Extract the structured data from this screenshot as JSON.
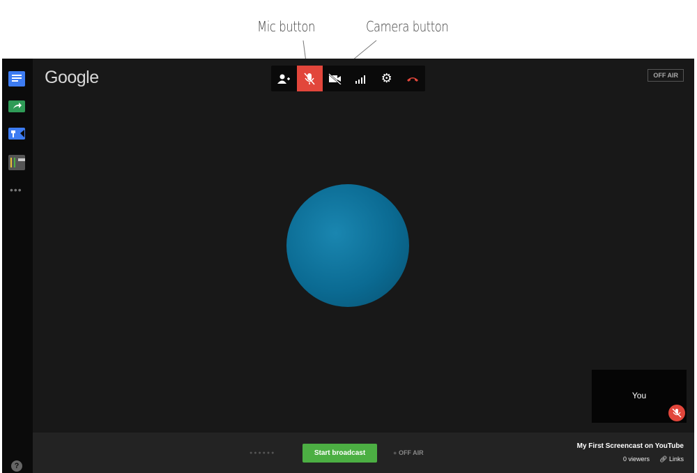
{
  "annotations": {
    "mic": "Mic button",
    "camera": "Camera button"
  },
  "logo": "Google",
  "toolbar": {
    "items": [
      "invite-icon",
      "mic-muted-icon",
      "camera-off-icon",
      "bandwidth-icon",
      "settings-icon",
      "hangup-icon"
    ],
    "mic_color": "#e2463b"
  },
  "status_badge": "OFF AIR",
  "self_view": {
    "label": "You"
  },
  "bottom": {
    "start_label": "Start broadcast",
    "status": "OFF AIR",
    "broadcast_title": "My First Screencast on YouTube",
    "viewers": "0 viewers",
    "links": "Links"
  },
  "help": "?"
}
